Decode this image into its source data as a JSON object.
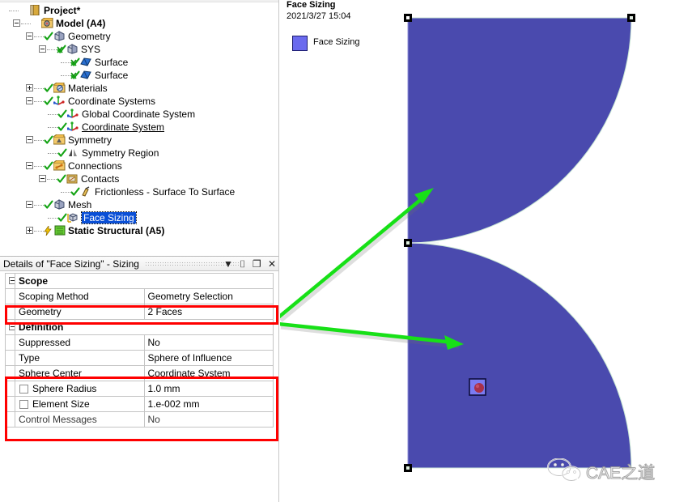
{
  "tree": {
    "items": [
      {
        "label": "Project*",
        "depth": 0,
        "icon": "project-icon",
        "bold": true,
        "expander": "none",
        "check": "none"
      },
      {
        "label": "Model (A4)",
        "depth": 1,
        "icon": "model-icon",
        "bold": true,
        "expander": "minus",
        "check": "none"
      },
      {
        "label": "Geometry",
        "depth": 2,
        "icon": "geometry-icon",
        "bold": false,
        "expander": "minus",
        "check": "green"
      },
      {
        "label": "SYS",
        "depth": 3,
        "icon": "geometry-icon",
        "bold": false,
        "expander": "minus",
        "check": "green-cross"
      },
      {
        "label": "Surface",
        "depth": 4,
        "icon": "surface-icon",
        "bold": false,
        "expander": "none",
        "check": "green-cross"
      },
      {
        "label": "Surface",
        "depth": 4,
        "icon": "surface-icon",
        "bold": false,
        "expander": "none",
        "check": "green-cross"
      },
      {
        "label": "Materials",
        "depth": 2,
        "icon": "materials-icon",
        "bold": false,
        "expander": "plus",
        "check": "green"
      },
      {
        "label": "Coordinate Systems",
        "depth": 2,
        "icon": "coordsys-icon",
        "bold": false,
        "expander": "minus",
        "check": "green"
      },
      {
        "label": "Global Coordinate System",
        "depth": 3,
        "icon": "coordsys-icon",
        "bold": false,
        "expander": "none",
        "check": "green"
      },
      {
        "label": "Coordinate System",
        "depth": 3,
        "icon": "coordsys-icon",
        "bold": false,
        "expander": "none",
        "check": "green",
        "underline": true
      },
      {
        "label": "Symmetry",
        "depth": 2,
        "icon": "symmetry-icon",
        "bold": false,
        "expander": "minus",
        "check": "green"
      },
      {
        "label": "Symmetry Region",
        "depth": 3,
        "icon": "symmetry-region-icon",
        "bold": false,
        "expander": "none",
        "check": "green"
      },
      {
        "label": "Connections",
        "depth": 2,
        "icon": "connections-icon",
        "bold": false,
        "expander": "minus",
        "check": "green"
      },
      {
        "label": "Contacts",
        "depth": 3,
        "icon": "contacts-icon",
        "bold": false,
        "expander": "minus",
        "check": "green"
      },
      {
        "label": "Frictionless - Surface To Surface",
        "depth": 4,
        "icon": "contact-pair-icon",
        "bold": false,
        "expander": "none",
        "check": "green"
      },
      {
        "label": "Mesh",
        "depth": 2,
        "icon": "mesh-icon",
        "bold": false,
        "expander": "minus",
        "check": "green"
      },
      {
        "label": "Face Sizing",
        "depth": 3,
        "icon": "face-sizing-icon",
        "bold": false,
        "expander": "none",
        "check": "green",
        "selected": true
      },
      {
        "label": "Static Structural (A5)",
        "depth": 2,
        "icon": "static-structural-icon",
        "bold": true,
        "expander": "plus",
        "check": "lightning"
      }
    ]
  },
  "details": {
    "title": "Details of \"Face Sizing\" - Sizing",
    "buttons": {
      "dropdown": "▼",
      "pin": "⌷",
      "maximize": "❐",
      "close": "✕"
    },
    "rows": [
      {
        "kind": "group",
        "key": "Scope"
      },
      {
        "kind": "pair",
        "key": "Scoping Method",
        "value": "Geometry Selection",
        "checkbox": false,
        "dim": false
      },
      {
        "kind": "pair",
        "key": "Geometry",
        "value": "2 Faces",
        "checkbox": false,
        "dim": false
      },
      {
        "kind": "group",
        "key": "Definition"
      },
      {
        "kind": "pair",
        "key": "Suppressed",
        "value": "No",
        "checkbox": false,
        "dim": false
      },
      {
        "kind": "pair",
        "key": "Type",
        "value": "Sphere of Influence",
        "checkbox": false,
        "dim": false
      },
      {
        "kind": "pair",
        "key": "Sphere Center",
        "value": "Coordinate System",
        "checkbox": false,
        "dim": false
      },
      {
        "kind": "pair",
        "key": "Sphere Radius",
        "value": "1.0 mm",
        "checkbox": true,
        "dim": false
      },
      {
        "kind": "pair",
        "key": "Element Size",
        "value": "1.e-002 mm",
        "checkbox": true,
        "dim": false
      },
      {
        "kind": "pair",
        "key": "Control Messages",
        "value": "No",
        "checkbox": false,
        "dim": true
      }
    ]
  },
  "legend": {
    "title": "Face Sizing",
    "date": "2021/3/27 15:04",
    "entry_label": "Face Sizing"
  },
  "watermark": {
    "text": "CAE之道",
    "icon": "wechat-icon"
  },
  "colors": {
    "face_blue": "#4a4aae",
    "legend_blue": "#6a6aee",
    "highlight_red": "#ff0000",
    "arrow_green": "#17e017",
    "selection_blue": "#0a4fd6",
    "sphere_red": "#a8304a"
  },
  "annotations": {
    "redbox_geometry": "Geometry row highlight",
    "redbox_sphere": "Sphere Center / Sphere Radius / Element Size highlight",
    "arrow_upper": "points to upper face",
    "arrow_lower": "points to lower face"
  }
}
